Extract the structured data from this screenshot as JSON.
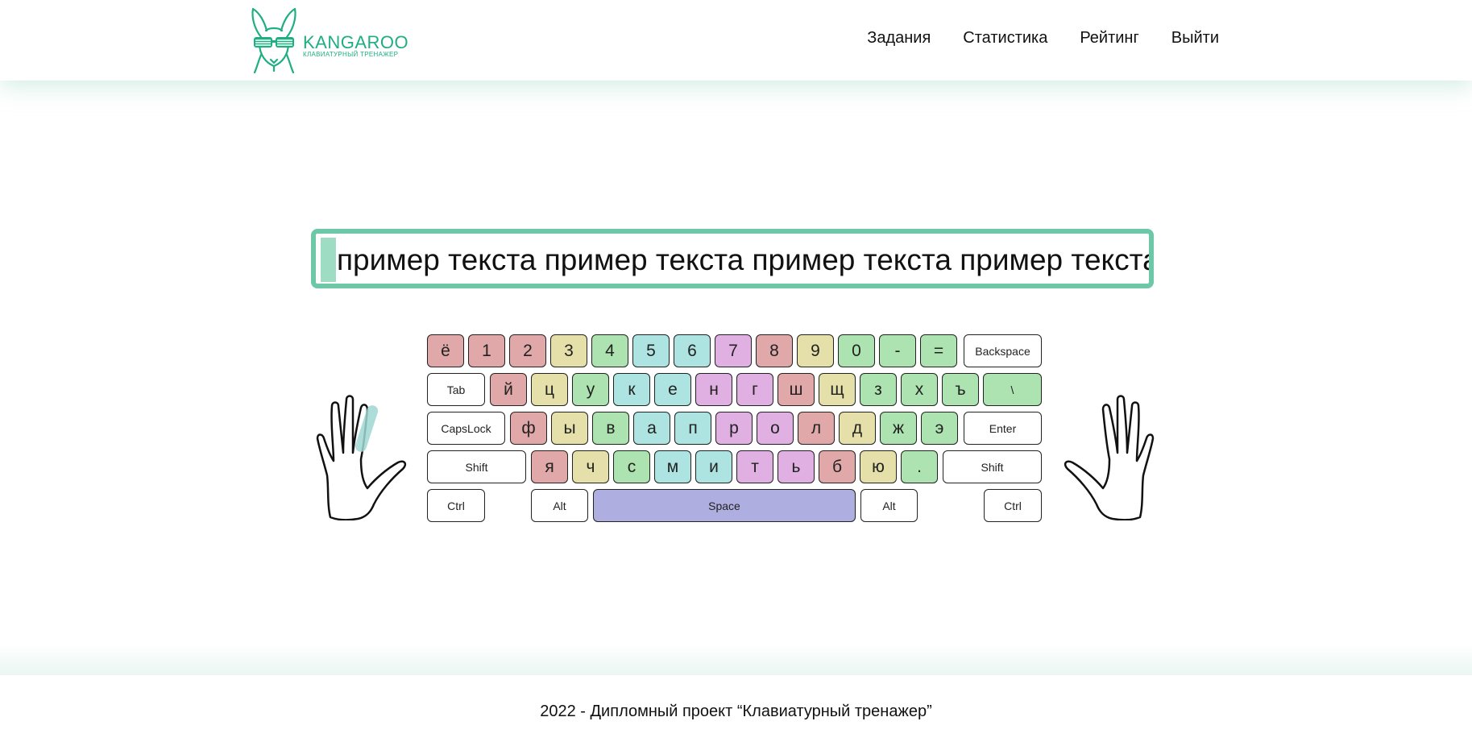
{
  "logo": {
    "title": "KANGAROO",
    "subtitle": "КЛАВИАТУРНЫЙ ТРЕНАЖЕР",
    "icon": "kangaroo-icon"
  },
  "nav": {
    "items": [
      "Задания",
      "Статистика",
      "Рейтинг",
      "Выйти"
    ]
  },
  "exercise": {
    "text": "пример текста пример текста пример текста пример текста"
  },
  "keyboard": {
    "rows": [
      [
        "ё",
        "1",
        "2",
        "3",
        "4",
        "5",
        "6",
        "7",
        "8",
        "9",
        "0",
        "-",
        "=",
        "Backspace"
      ],
      [
        "Tab",
        "й",
        "ц",
        "у",
        "к",
        "е",
        "н",
        "г",
        "ш",
        "щ",
        "з",
        "х",
        "ъ",
        "\\"
      ],
      [
        "CapsLock",
        "ф",
        "ы",
        "в",
        "а",
        "п",
        "р",
        "о",
        "л",
        "д",
        "ж",
        "э",
        "Enter"
      ],
      [
        "Shift",
        "я",
        "ч",
        "с",
        "м",
        "и",
        "т",
        "ь",
        "б",
        "ю",
        ".",
        "Shift"
      ],
      [
        "Ctrl",
        "Alt",
        "Space",
        "Alt",
        "Ctrl"
      ]
    ]
  },
  "colors": {
    "accent": "#6cc8a6",
    "logo": "#1fae82",
    "red": "#e0a8a8",
    "yellow": "#e5dfa9",
    "green": "#ace3b0",
    "teal": "#ade3e0",
    "purple": "#e0b0e2",
    "space": "#afaee0"
  },
  "footer": {
    "text": "2022 - Дипломный проект “Клавиатурный тренажер”"
  }
}
